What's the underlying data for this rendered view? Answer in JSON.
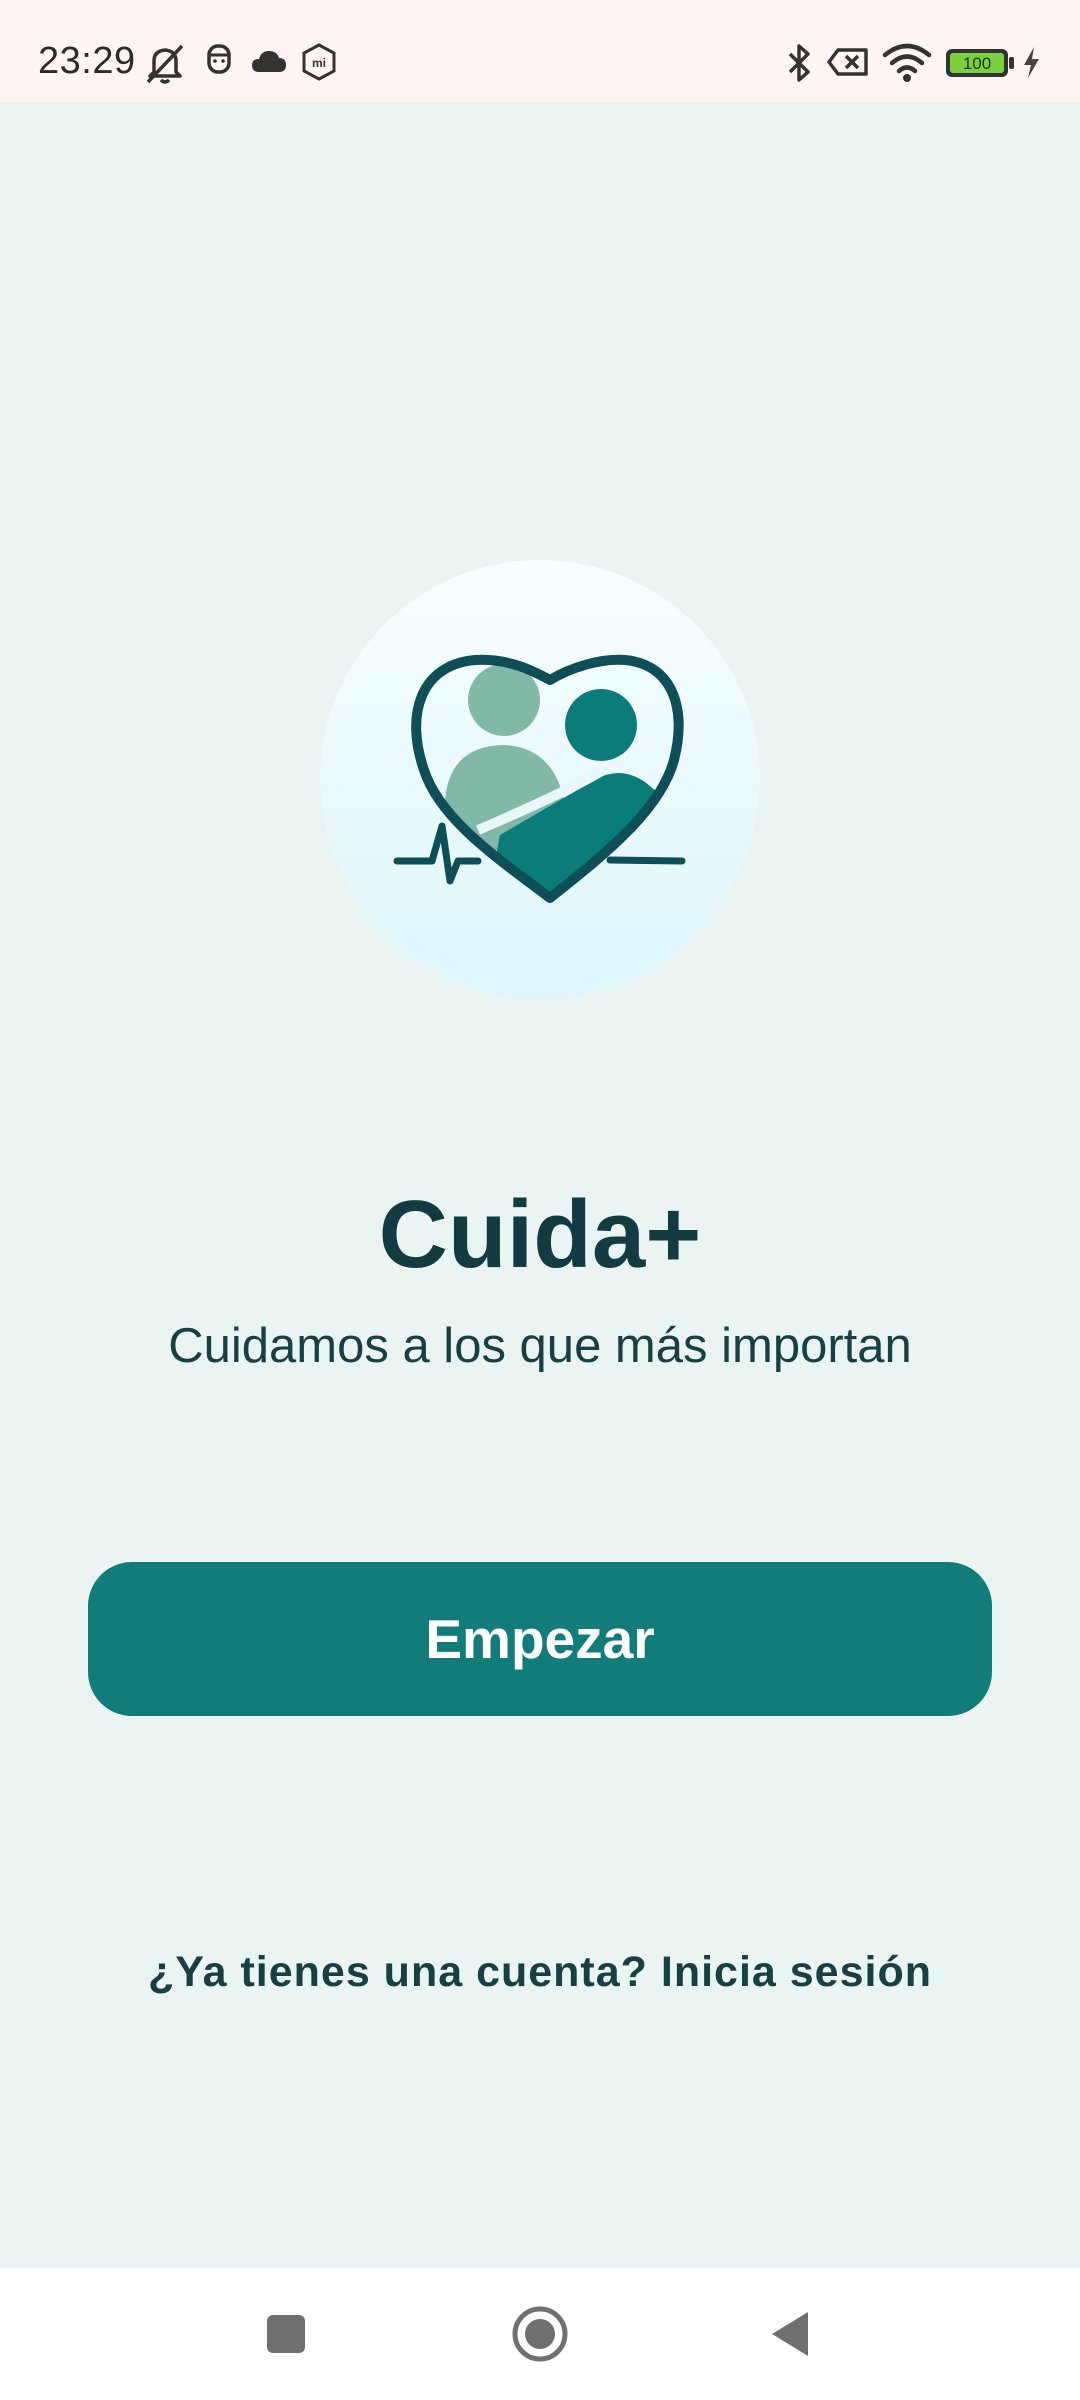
{
  "status_bar": {
    "time": "23:29",
    "battery_level": "100",
    "icons": [
      "mute-icon",
      "face-icon",
      "cloud-icon",
      "mi-icon",
      "bluetooth-icon",
      "sim-x-icon",
      "wifi-icon",
      "battery-icon",
      "charging-icon"
    ]
  },
  "app": {
    "name": "Cuida+",
    "tagline": "Cuidamos a los que más importan"
  },
  "actions": {
    "start_label": "Empezar",
    "login_label": "¿Ya tienes una cuenta? Inicia sesión"
  },
  "nav": {
    "icons": [
      "recents-icon",
      "home-icon",
      "back-icon"
    ]
  },
  "colors": {
    "background": "#e9f4f3",
    "primary": "#117c7a",
    "dark_text": "#123c41",
    "logo_dark": "#0d4e57",
    "logo_light": "#81b8a6",
    "logo_teal": "#0b7c79"
  }
}
